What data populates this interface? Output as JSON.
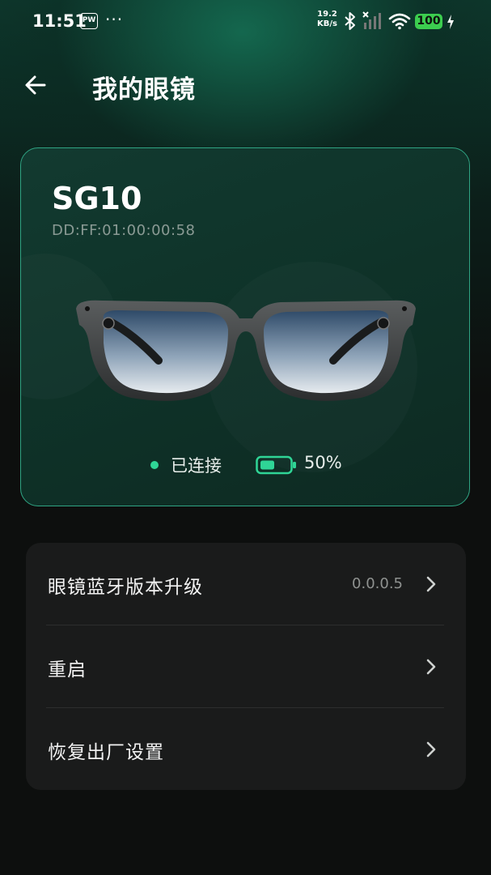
{
  "status_bar": {
    "time": "11:51",
    "app_badge": "PW",
    "more_dots": "···",
    "net_speed_value": "19.2",
    "net_speed_unit": "KB/s",
    "battery_level": "100",
    "icons": [
      "bluetooth-icon",
      "signal-off-icon",
      "wifi-icon",
      "battery-icon",
      "charging-bolt-icon"
    ]
  },
  "header": {
    "title": "我的眼镜",
    "back_icon": "back-arrow-icon"
  },
  "device": {
    "name": "SG10",
    "mac": "DD:FF:01:00:00:58",
    "connection_status": "已连接",
    "battery_percent": "50%",
    "battery_fraction": 0.5,
    "accent_color": "#2fd596"
  },
  "settings": {
    "items": [
      {
        "label": "眼镜蓝牙版本升级",
        "value": "0.0.0.5"
      },
      {
        "label": "重启",
        "value": ""
      },
      {
        "label": "恢复出厂设置",
        "value": ""
      }
    ]
  }
}
